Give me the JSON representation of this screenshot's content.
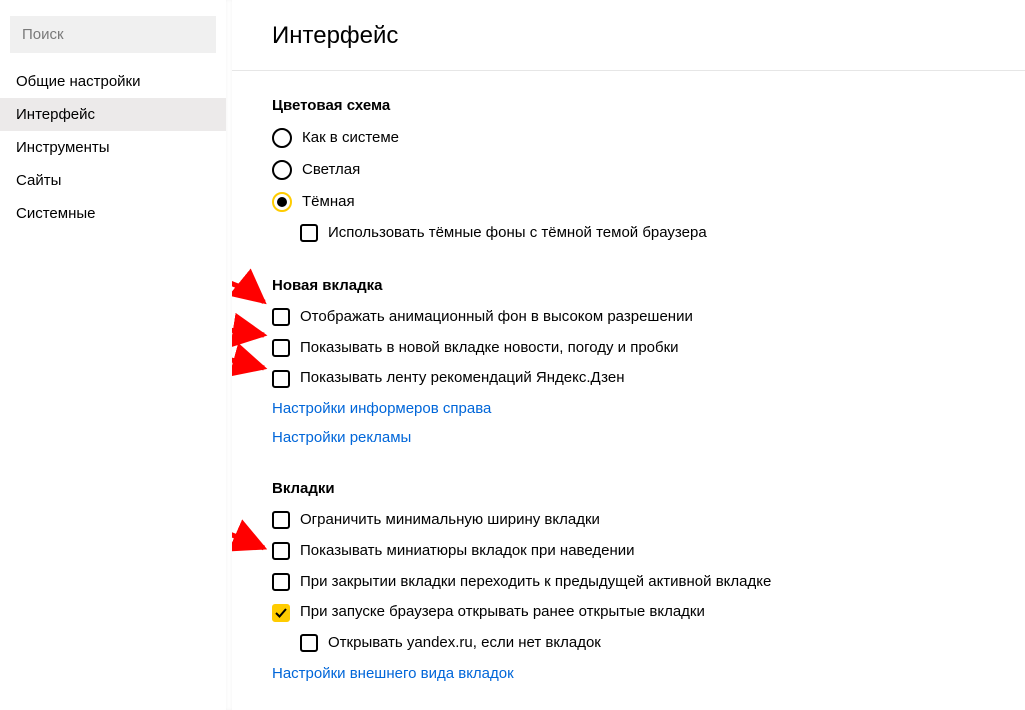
{
  "sidebar": {
    "search_placeholder": "Поиск",
    "items": [
      {
        "label": "Общие настройки",
        "active": false
      },
      {
        "label": "Интерфейс",
        "active": true
      },
      {
        "label": "Инструменты",
        "active": false
      },
      {
        "label": "Сайты",
        "active": false
      },
      {
        "label": "Системные",
        "active": false
      }
    ]
  },
  "page": {
    "title": "Интерфейс"
  },
  "sections": {
    "color_scheme": {
      "title": "Цветовая схема",
      "options": [
        {
          "label": "Как в системе",
          "selected": false
        },
        {
          "label": "Светлая",
          "selected": false
        },
        {
          "label": "Тёмная",
          "selected": true
        }
      ],
      "sub_checkbox": {
        "label": "Использовать тёмные фоны с тёмной темой браузера",
        "checked": false
      }
    },
    "new_tab": {
      "title": "Новая вкладка",
      "checkboxes": [
        {
          "label": "Отображать анимационный фон в высоком разрешении",
          "checked": false
        },
        {
          "label": "Показывать в новой вкладке новости, погоду и пробки",
          "checked": false
        },
        {
          "label": "Показывать ленту рекомендаций Яндекс.Дзен",
          "checked": false
        }
      ],
      "links": [
        "Настройки информеров справа",
        "Настройки рекламы"
      ]
    },
    "tabs": {
      "title": "Вкладки",
      "checkboxes": [
        {
          "label": "Ограничить минимальную ширину вкладки",
          "checked": false,
          "sub": false
        },
        {
          "label": "Показывать миниатюры вкладок при наведении",
          "checked": false,
          "sub": false
        },
        {
          "label": "При закрытии вкладки переходить к предыдущей активной вкладке",
          "checked": false,
          "sub": false
        },
        {
          "label": "При запуске браузера открывать ранее открытые вкладки",
          "checked": true,
          "sub": false
        },
        {
          "label": "Открывать yandex.ru, если нет вкладок",
          "checked": false,
          "sub": true
        }
      ],
      "link": "Настройки внешнего вида вкладок"
    }
  }
}
